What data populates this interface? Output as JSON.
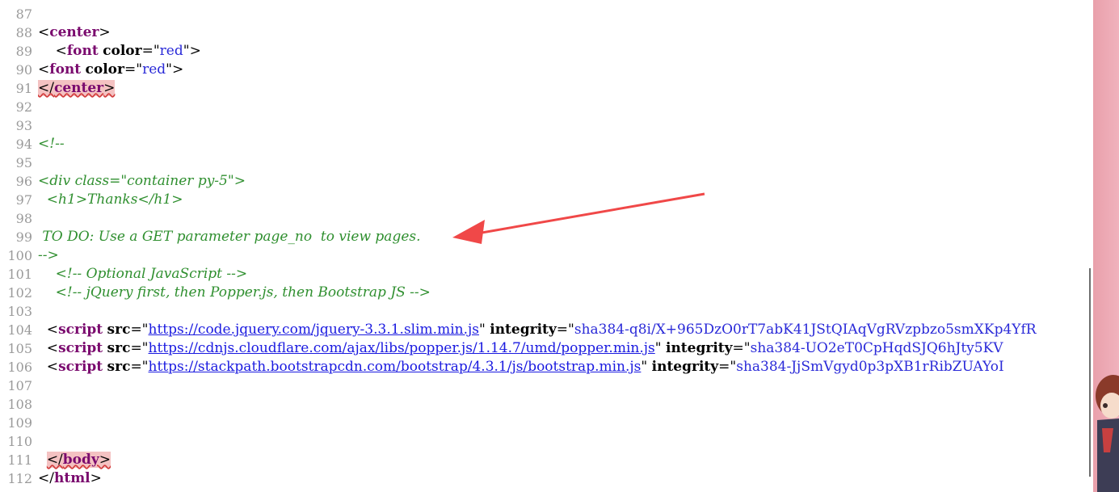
{
  "lines": [
    {
      "n": "87",
      "t": ""
    },
    {
      "n": "88",
      "t": ""
    },
    {
      "n": "89",
      "t": ""
    },
    {
      "n": "90",
      "t": ""
    },
    {
      "n": "91",
      "t": ""
    },
    {
      "n": "92",
      "t": ""
    },
    {
      "n": "93",
      "t": ""
    },
    {
      "n": "94",
      "t": ""
    },
    {
      "n": "95",
      "t": ""
    },
    {
      "n": "96",
      "t": ""
    },
    {
      "n": "97",
      "t": ""
    },
    {
      "n": "98",
      "t": ""
    },
    {
      "n": "99",
      "t": ""
    },
    {
      "n": "100",
      "t": ""
    },
    {
      "n": "101",
      "t": ""
    },
    {
      "n": "102",
      "t": ""
    },
    {
      "n": "103",
      "t": ""
    },
    {
      "n": "104",
      "t": ""
    },
    {
      "n": "105",
      "t": ""
    },
    {
      "n": "106",
      "t": ""
    },
    {
      "n": "107",
      "t": ""
    },
    {
      "n": "108",
      "t": ""
    },
    {
      "n": "109",
      "t": ""
    },
    {
      "n": "110",
      "t": ""
    },
    {
      "n": "111",
      "t": ""
    },
    {
      "n": "112",
      "t": ""
    }
  ],
  "code": {
    "l88_tag": "center",
    "l89_tag": "font",
    "l89_attr": "color",
    "l89_val": "red",
    "l90_tag": "font",
    "l90_attr": "color",
    "l90_val": "red",
    "l91_tag": "center",
    "l94": "<!--",
    "l96": "<div class=\"container py-5\">",
    "l97": "  <h1>Thanks</h1>",
    "l99": " TO DO: Use a GET parameter page_no  to view pages.",
    "l100": "-->",
    "l101": "    <!-- Optional JavaScript -->",
    "l102": "    <!-- jQuery first, then Popper.js, then Bootstrap JS -->",
    "script_tag": "script",
    "src_attr": "src",
    "integrity_attr": "integrity",
    "l104_url": "https://code.jquery.com/jquery-3.3.1.slim.min.js",
    "l104_int": "sha384-q8i/X+965DzO0rT7abK41JStQIAqVgRVzpbzo5smXKp4YfR",
    "l105_url": "https://cdnjs.cloudflare.com/ajax/libs/popper.js/1.14.7/umd/popper.min.js",
    "l105_int": "sha384-UO2eT0CpHqdSJQ6hJty5KV",
    "l106_url": "https://stackpath.bootstrapcdn.com/bootstrap/4.3.1/js/bootstrap.min.js",
    "l106_int": "sha384-JjSmVgyd0p3pXB1rRibZUAYoI",
    "l111_tag": "body",
    "l112_tag": "html"
  },
  "colors": {
    "tag": "#7a0a6e",
    "string": "#2a2ad8",
    "comment": "#2f8f2f",
    "annotation_arrow": "#f04848",
    "scrollbar": "#e9a0ab"
  },
  "icons": [
    "annotation-arrow",
    "mascot-avatar"
  ]
}
